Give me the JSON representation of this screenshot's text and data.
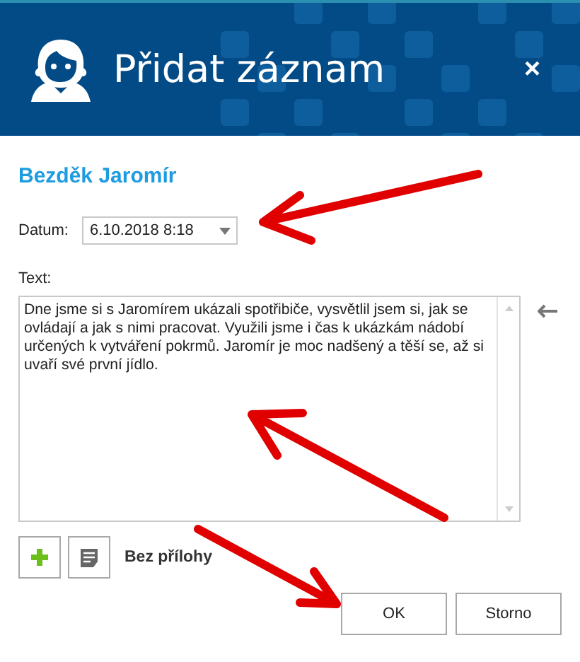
{
  "header": {
    "title": "Přidat záznam",
    "close": "×"
  },
  "client": {
    "name": "Bezděk Jaromír"
  },
  "date": {
    "label": "Datum:",
    "value": "6.10.2018 8:18"
  },
  "note": {
    "label": "Text:",
    "value": "Dne jsme si s Jaromírem ukázali spotřibiče, vysvětlil jsem si, jak se ovládají a jak s nimi pracovat. Využili jsme i čas k ukázkám nádobí určených k vytváření pokrmů. Jaromír je moc nadšený a těší se, až si uvaří své první jídlo."
  },
  "attachments": {
    "status": "Bez přílohy"
  },
  "buttons": [
    {
      "label": "OK"
    },
    {
      "label": "Storno"
    }
  ]
}
